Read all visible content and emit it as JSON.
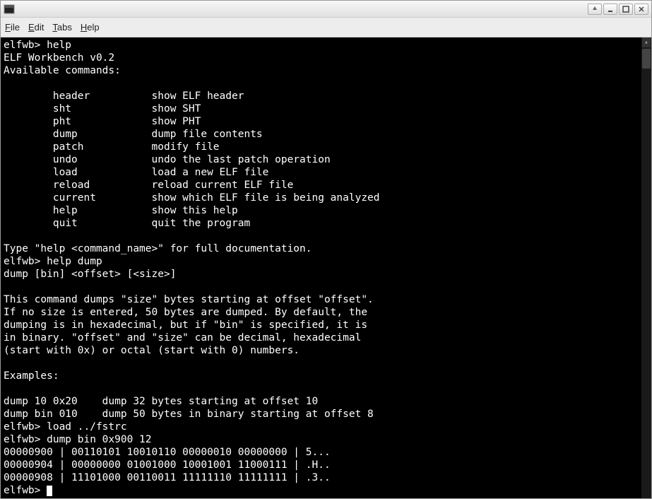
{
  "titlebar": {
    "icon_glyph": "🖳"
  },
  "menubar": {
    "file": "File",
    "edit": "Edit",
    "tabs": "Tabs",
    "help": "Help"
  },
  "terminal": {
    "lines": [
      "elfwb> help",
      "ELF Workbench v0.2",
      "Available commands:",
      "",
      "        header          show ELF header",
      "        sht             show SHT",
      "        pht             show PHT",
      "        dump            dump file contents",
      "        patch           modify file",
      "        undo            undo the last patch operation",
      "        load            load a new ELF file",
      "        reload          reload current ELF file",
      "        current         show which ELF file is being analyzed",
      "        help            show this help",
      "        quit            quit the program",
      "",
      "Type \"help <command_name>\" for full documentation.",
      "elfwb> help dump",
      "dump [bin] <offset> [<size>]",
      "",
      "This command dumps \"size\" bytes starting at offset \"offset\".",
      "If no size is entered, 50 bytes are dumped. By default, the",
      "dumping is in hexadecimal, but if \"bin\" is specified, it is",
      "in binary. \"offset\" and \"size\" can be decimal, hexadecimal",
      "(start with 0x) or octal (start with 0) numbers.",
      "",
      "Examples:",
      "",
      "dump 10 0x20    dump 32 bytes starting at offset 10",
      "dump bin 010    dump 50 bytes in binary starting at offset 8",
      "elfwb> load ../fstrc",
      "elfwb> dump bin 0x900 12",
      "00000900 | 00110101 10010110 00000010 00000000 | 5...",
      "00000904 | 00000000 01001000 10001001 11000111 | .H..",
      "00000908 | 11101000 00110011 11111110 11111111 | .3.."
    ],
    "prompt": "elfwb> "
  }
}
